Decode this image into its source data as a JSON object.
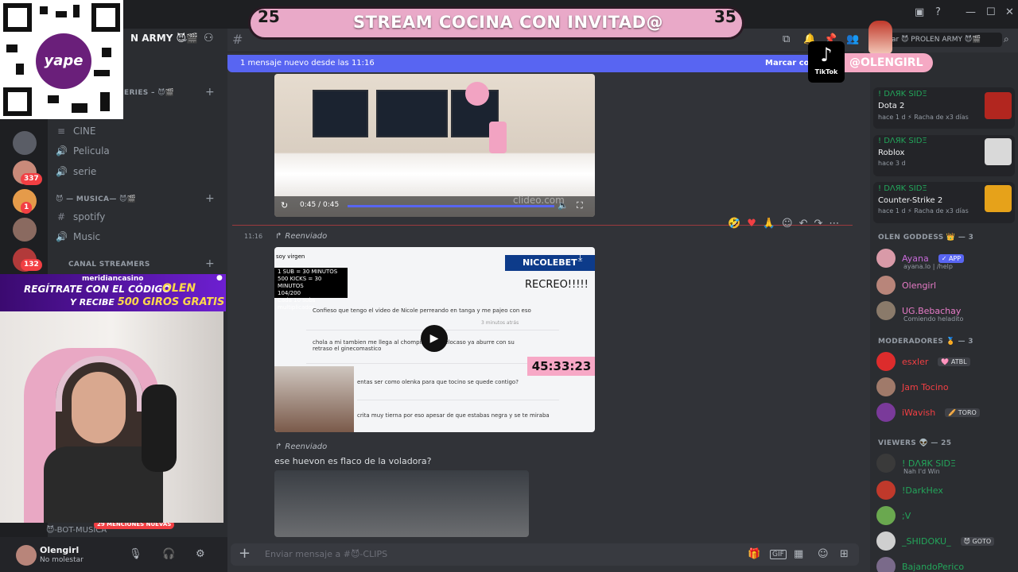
{
  "colors": {
    "accent": "#5865f2",
    "online": "#23a55a",
    "danger": "#f23f43",
    "overlay_pink": "#e9a9c8"
  },
  "stream": {
    "title": "STREAM COCINA CON INVITAD@",
    "left_number": "25",
    "right_number": "35",
    "tiktok_label": "TikTok",
    "tiktok_handle": "@OLENGIRL",
    "qr_brand": "yape",
    "casino": {
      "brand": "meridiancasino",
      "line1": "REGÍTRATE CON EL CÓDIGO",
      "code": "OLEN",
      "line2_prefix": "Y RECIBE",
      "line2_bonus": "500 GIROS GRATIS"
    },
    "clip_timer": "45:33:23",
    "clip_banner": "NICOLEBET",
    "clip_recreo": "RECREO!!!!!",
    "clip_sub_info": [
      "1 SUB = 30 MINUTOS",
      "500 KICKS = 30 MINUTOS",
      "104/200",
      "Cada 10 subs multiplicador"
    ],
    "clip_topline": "soy virgen"
  },
  "server": {
    "name": "N ARMY 😈🎬"
  },
  "channels": {
    "cat_series": "ERIES – 😈🎬",
    "items": [
      {
        "icon": "hash-icon",
        "glyph": "≡",
        "label": "CINE"
      },
      {
        "icon": "speaker-icon",
        "glyph": "🔊",
        "label": "Pelicula"
      },
      {
        "icon": "speaker-icon",
        "glyph": "🔊",
        "label": "serie"
      }
    ],
    "cat_musica": "😈 — MUSICA— 😈🎬",
    "music_items": [
      {
        "icon": "hash-icon",
        "glyph": "#",
        "label": "spotify"
      },
      {
        "icon": "speaker-icon",
        "glyph": "🔊",
        "label": "Music"
      }
    ],
    "cat_streamers": "CANAL STREAMERS",
    "bot_musica": "😈-BOT-MUSICA",
    "menciones": "29 MENCIONES NUEVAS"
  },
  "rail_badges": [
    "337",
    "1",
    "132"
  ],
  "user": {
    "name": "Olengirl",
    "status": "No molestar"
  },
  "header": {
    "new_messages": "1 mensaje nuevo desde las 11:16",
    "mark_read": "Marcar co",
    "search_placeholder": "car 😈 PROLEN ARMY 😈🎬"
  },
  "messages": {
    "video1_time": "0:45 / 0:45",
    "video1_watermark": "clideo.com",
    "msg_time": "11:16",
    "forwarded": "Reenviado",
    "clip_comments": [
      "Confieso que tengo el video de Nicole perreando en tanga y me pajeo con eso",
      "chola a mi tambien me llega al chompiras el axelocaso ya aburre con su retraso el ginecomastico",
      "entas ser como olenka para que tocino se quede contigo?",
      "crita muy tierna por eso apesar de que estabas negra y se te miraba"
    ],
    "clip_time_ago": "3 minutos atrás",
    "message_text": "ese huevon es flaco de la voladora?"
  },
  "composer": {
    "placeholder": "Enviar mensaje a #😈-CLIPS"
  },
  "activities": [
    {
      "name": "! DΛЯK SIDΞ",
      "game": "Dota 2",
      "meta": "hace 1 d  ⚡ Racha de x3 días",
      "color": "#b2261f"
    },
    {
      "name": "! DΛЯK SIDΞ",
      "game": "Roblox",
      "meta": "hace 3 d",
      "color": "#d9d9d9"
    },
    {
      "name": "! DΛЯK SIDΞ",
      "game": "Counter-Strike 2",
      "meta": "hace 1 d  ⚡ Racha de x3 días",
      "color": "#e6a21a"
    }
  ],
  "groups": {
    "goddess": "OLEN GODDESS 👑 — 3",
    "mods": "MODERADORES 🏅 — 3",
    "viewers": "VIEWERS 👽 — 25"
  },
  "goddess_members": [
    {
      "name": "Ayana",
      "tag": "✓ APP",
      "sub": "ayana.lo | /help",
      "color": "#c86ad9"
    },
    {
      "name": "Olengirl",
      "tag": "",
      "sub": "",
      "color": "#e77bc7"
    },
    {
      "name": "UG.Bebachay",
      "tag": "",
      "sub": "Comiendo heladito",
      "color": "#e77bc7"
    }
  ],
  "mod_members": [
    {
      "name": "esxler",
      "tag": "🩷 ATBL",
      "color": "#f23f43"
    },
    {
      "name": "Jam Tocino",
      "tag": "",
      "color": "#f23f43"
    },
    {
      "name": "iWavish",
      "tag": "🥖 TORO",
      "color": "#f23f43"
    }
  ],
  "viewer_members": [
    {
      "name": "! DΛЯK SIDΞ",
      "tag": "",
      "sub": "Nah I'd Win",
      "color": "#23a55a"
    },
    {
      "name": "!DarkHex",
      "tag": "",
      "sub": "",
      "color": "#23a55a"
    },
    {
      "name": ";V",
      "tag": "",
      "sub": "",
      "color": "#23a55a"
    },
    {
      "name": "_SHIDOKU_",
      "tag": "😈 GOTO",
      "sub": "",
      "color": "#23a55a"
    },
    {
      "name": "BajandoPerico",
      "tag": "",
      "sub": "",
      "color": "#23a55a"
    }
  ]
}
